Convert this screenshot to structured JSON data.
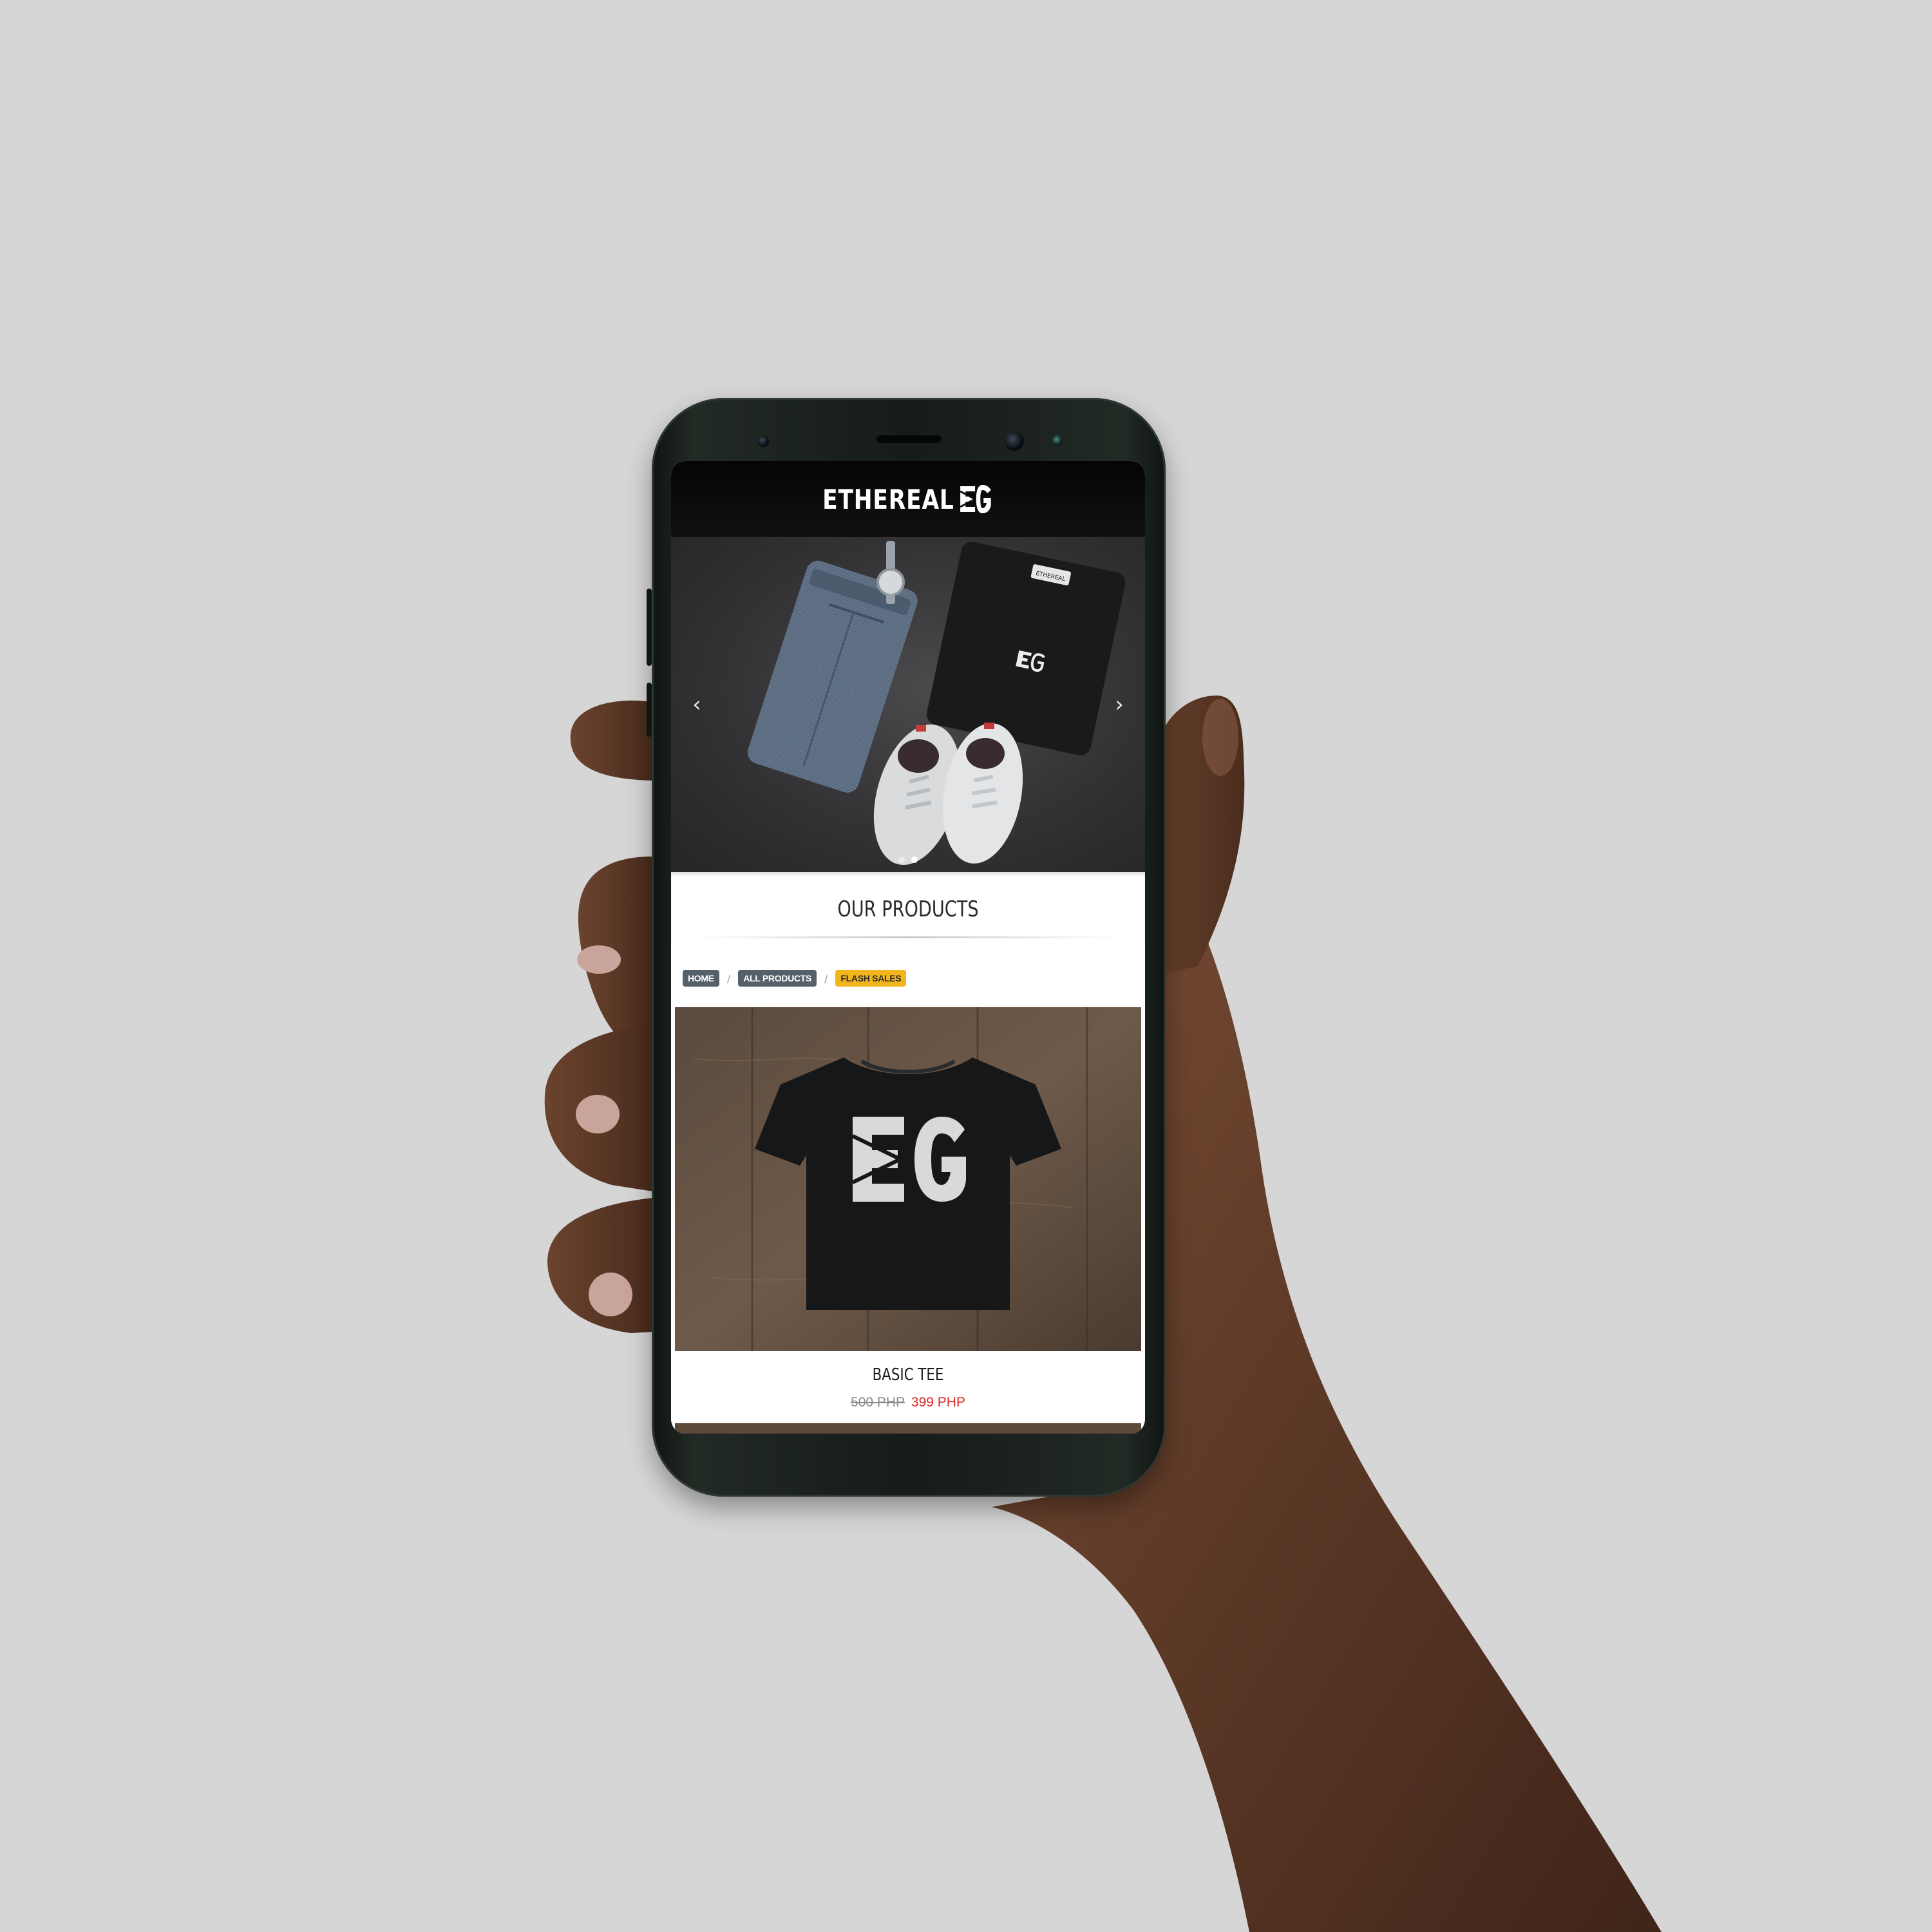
{
  "app": {
    "brand_name": "ETHEREAL",
    "logo_icon": "eg-monogram-logo"
  },
  "hero": {
    "prev_icon": "chevron-left-icon",
    "next_icon": "chevron-right-icon",
    "prev_glyph": "‹",
    "next_glyph": "›",
    "slide_count": 2,
    "active_slide": 2
  },
  "section": {
    "title": "OUR PRODUCTS"
  },
  "breadcrumb": {
    "items": [
      {
        "label": "HOME"
      },
      {
        "label": "ALL PRODUCTS"
      },
      {
        "label": "FLASH SALES"
      }
    ],
    "separator": "/"
  },
  "products": [
    {
      "name": "BASIC TEE",
      "old_price": "500 PHP",
      "new_price": "399 PHP"
    }
  ],
  "colors": {
    "accent": "#f2b61c",
    "sale_price": "#d32a2a",
    "crumb_bg": "#566068",
    "topbar_bg": "#0a0a0a",
    "background": "#d6d6d6"
  }
}
